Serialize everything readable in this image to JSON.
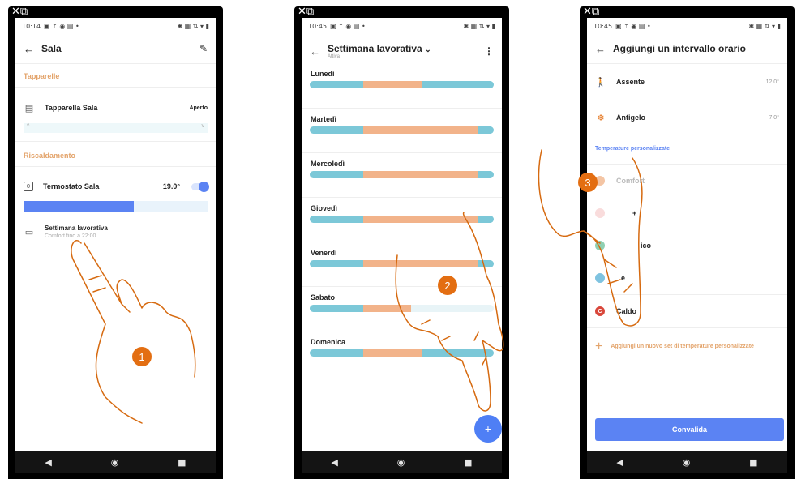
{
  "phone1": {
    "time": "10:14",
    "title": "Sala",
    "section_blinds": "Tapparelle",
    "blind_name": "Tapparella Sala",
    "blind_state": "Aperto",
    "section_heating": "Riscaldamento",
    "thermostat_name": "Termostato Sala",
    "thermostat_temp": "19.0°",
    "program_name": "Settimana lavorativa",
    "program_detail": "Comfort fino a 22:00",
    "step": "1"
  },
  "phone2": {
    "time": "10:45",
    "title": "Settimana lavorativa",
    "subtitle": "Attiva",
    "days": [
      "Lunedì",
      "Martedì",
      "Mercoledì",
      "Giovedì",
      "Venerdì",
      "Sabato",
      "Domenica"
    ],
    "step": "2"
  },
  "phone3": {
    "time": "10:45",
    "title": "Aggiungi un intervallo orario",
    "absent_label": "Assente",
    "absent_temp": "12.0°",
    "antifreeze_label": "Antigelo",
    "antifreeze_temp": "7.0°",
    "custom_section": "Temperature personalizzate",
    "comfort_label": "Comfort",
    "comfort_plus_label": "+",
    "eco_label": "ico",
    "night_label": "e",
    "warm_label": "Caldo",
    "warm_letter": "C",
    "add_set_label": "Aggiungi un nuovo set di temperature personalizzate",
    "validate_label": "Convalida",
    "step": "3"
  },
  "nav": {
    "back": "◀",
    "home": "◉",
    "recent": "■"
  },
  "colors": {
    "accent_orange": "#e3a36a",
    "bar_blue": "#7cc8d8",
    "bar_orange": "#f2b38a",
    "primary_blue": "#5b83f3",
    "badge_orange": "#e36e12"
  }
}
